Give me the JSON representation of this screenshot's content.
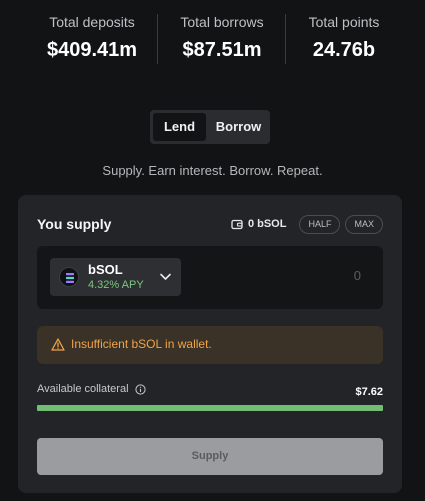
{
  "stats": {
    "deposits": {
      "label": "Total deposits",
      "value": "$409.41m"
    },
    "borrows": {
      "label": "Total borrows",
      "value": "$87.51m"
    },
    "points": {
      "label": "Total points",
      "value": "24.76b"
    }
  },
  "mode_toggle": {
    "lend_label": "Lend",
    "borrow_label": "Borrow",
    "selected": "Lend"
  },
  "tagline": "Supply. Earn interest. Borrow. Repeat.",
  "supply_panel": {
    "title": "You supply",
    "wallet_icon": "wallet-icon",
    "wallet_balance": "0 bSOL",
    "half_label": "HALF",
    "max_label": "MAX",
    "token": {
      "name": "bSOL",
      "apy": "4.32% APY",
      "icon": "bsol-logo",
      "chevron": "chevron-down-icon"
    },
    "amount": "0",
    "warning": {
      "icon": "warning-icon",
      "text": "Insufficient bSOL in wallet.",
      "color": "#f0a448"
    },
    "collateral": {
      "label": "Available collateral",
      "icon": "info-icon",
      "value": "$7.62",
      "fill_fraction": 1.0,
      "bar_color": "#72bd73"
    },
    "submit_label": "Supply"
  }
}
